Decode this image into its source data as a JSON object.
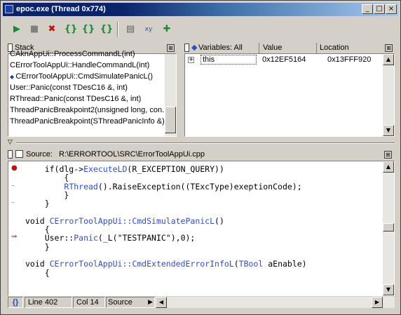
{
  "window": {
    "title": "epoc.exe (Thread 0x774)",
    "min": "_",
    "max": "□",
    "close": "×"
  },
  "toolbar": {
    "run": "▶",
    "stop": "■",
    "kill": "✖",
    "step_over": "{}",
    "step_into": "{}",
    "step_out": "{}",
    "view1": "▤",
    "view2": "xy",
    "view3": "✚"
  },
  "stack": {
    "title": "Stack",
    "rows": [
      "CAknAppUi::ProcessCommandL(int)",
      "CErrorToolAppUi::HandleCommandL(int)",
      "CErrorToolAppUi::CmdSimulatePanicL()",
      "User::Panic(const TDesC16 &, int)",
      "RThread::Panic(const TDesC16 &, int)",
      "ThreadPanicBreakpoint2(unsigned long, con...",
      "ThreadPanicBreakpoint(SThreadPanicInfo &)"
    ],
    "current_index": 2
  },
  "variables": {
    "title": "Variables: All",
    "col_value": "Value",
    "col_location": "Location",
    "rows": [
      {
        "name": "this",
        "value": "0x12EF5164",
        "location": "0x13FFF920"
      }
    ]
  },
  "source": {
    "label": "Source:",
    "path": "R:\\ERRORTOOL\\SRC\\ErrorToolAppUi.cpp",
    "lines": [
      {
        "gutter": "●",
        "text": "    if(dlg->ExecuteLD(R_EXCEPTION_QUERY))"
      },
      {
        "gutter": "",
        "text": "        {"
      },
      {
        "gutter": "–",
        "text": "        RThread().RaiseException((TExcType)exeptionCode);"
      },
      {
        "gutter": "",
        "text": "        }"
      },
      {
        "gutter": "–",
        "text": "    }"
      },
      {
        "gutter": "",
        "text": ""
      },
      {
        "gutter": "",
        "text": "void CErrorToolAppUi::CmdSimulatePanicL()"
      },
      {
        "gutter": "",
        "text": "    {"
      },
      {
        "gutter": "⇒",
        "text": "    User::Panic(_L(\"TESTPANIC\"),0);"
      },
      {
        "gutter": "",
        "text": "    }"
      },
      {
        "gutter": "",
        "text": ""
      },
      {
        "gutter": "",
        "text": "void CErrorToolAppUi::CmdExtendedErrorInfoL(TBool aEnable)"
      },
      {
        "gutter": "",
        "text": "    {"
      }
    ]
  },
  "status": {
    "braces": "{}",
    "line": "Line 402",
    "col": "Col 14",
    "mode": "Source"
  }
}
